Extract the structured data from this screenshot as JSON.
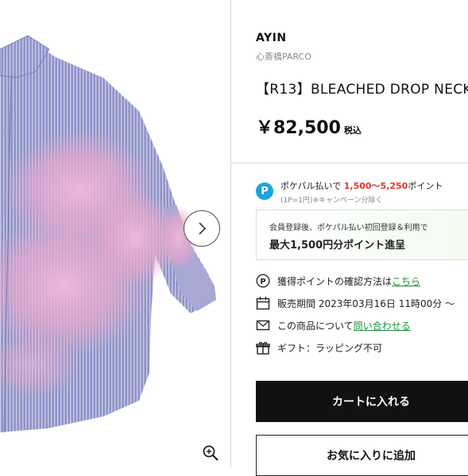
{
  "product": {
    "brand": "AYIN",
    "store": "心斎橋PARCO",
    "title": "【R13】BLEACHED DROP NECK",
    "price": "￥82,500",
    "tax_label": "税込"
  },
  "pokepal": {
    "prefix": "ポケパル払いで ",
    "range": "1,500～5,250",
    "suffix": "ポイント",
    "note": "(1P=1円)※キャンペーン分除く"
  },
  "promo": {
    "line1": "会員登録後、ポケパル払い初回登録＆利用で",
    "line2": "最大1,500円分ポイント進呈"
  },
  "info_rows": {
    "points_text": "獲得ポイントの確認方法は",
    "points_link": "こちら",
    "sale_label": "販売期間",
    "sale_value": "2023年03月16日 11時00分 ～",
    "inquiry_text": "この商品について",
    "inquiry_link": "問い合わせる",
    "gift_text": "ギフト：ラッピング不可"
  },
  "buttons": {
    "cart": "カートに入れる",
    "favorite": "お気に入りに追加"
  },
  "icons": [
    "chevron-right-icon",
    "zoom-in-icon",
    "pokepal-icon",
    "point-icon",
    "calendar-icon",
    "mail-icon",
    "gift-icon"
  ],
  "colors": {
    "accent_red": "#e0382a",
    "link_green": "#1a8f3c",
    "pokepal_blue": "#1aa4e0",
    "cart_button": "#111111"
  }
}
